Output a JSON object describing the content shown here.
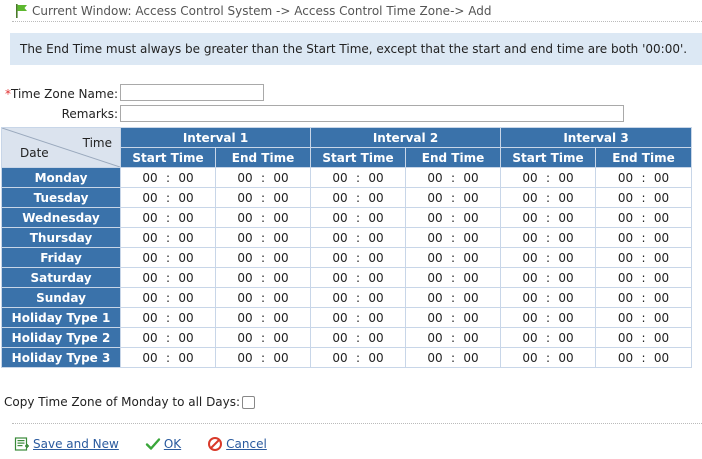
{
  "breadcrumb": {
    "text": "Current Window: Access Control System -> Access Control Time Zone-> Add"
  },
  "notice": "The End Time must always be greater than the Start Time, except that the start and end time are both '00:00'.",
  "form": {
    "required_mark": "*",
    "tz_name_label": "Time Zone Name:",
    "tz_name_value": "",
    "remarks_label": "Remarks:",
    "remarks_value": ""
  },
  "table": {
    "corner_time": "Time",
    "corner_date": "Date",
    "intervals": [
      "Interval 1",
      "Interval 2",
      "Interval 3"
    ],
    "start_label": "Start Time",
    "end_label": "End Time",
    "days": [
      "Monday",
      "Tuesday",
      "Wednesday",
      "Thursday",
      "Friday",
      "Saturday",
      "Sunday",
      "Holiday Type 1",
      "Holiday Type 2",
      "Holiday Type 3"
    ],
    "time_value": {
      "hh": "00",
      "sep": ":",
      "mm": "00"
    }
  },
  "copy": {
    "label": "Copy Time Zone of Monday to all Days:",
    "checked": false
  },
  "actions": {
    "save_new": "Save and New",
    "ok": "OK",
    "cancel": "Cancel"
  },
  "colors": {
    "header_blue": "#3a72aa",
    "notice_bg": "#dce8f4",
    "link": "#2a5a9e"
  }
}
